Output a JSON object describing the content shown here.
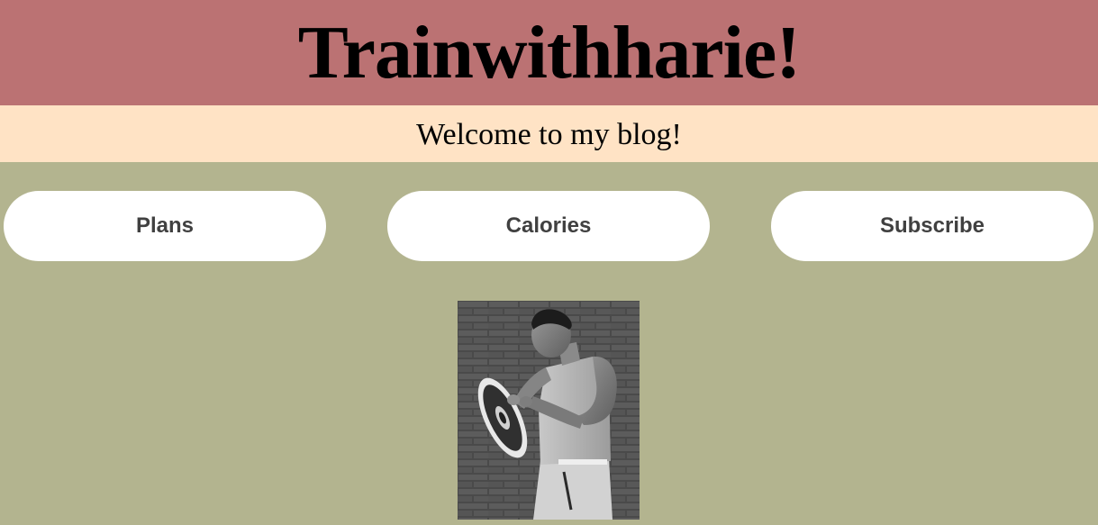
{
  "header": {
    "title": "Trainwithharie!",
    "background": "#bb7273"
  },
  "welcome": {
    "text": "Welcome to my blog!",
    "background": "#ffe3c5"
  },
  "nav": {
    "buttons": [
      {
        "label": "Plans"
      },
      {
        "label": "Calories"
      },
      {
        "label": "Subscribe"
      }
    ]
  },
  "page": {
    "background": "#b3b48f"
  },
  "hero_image": {
    "icon": "photo-of-man-lifting-weight-plate"
  }
}
